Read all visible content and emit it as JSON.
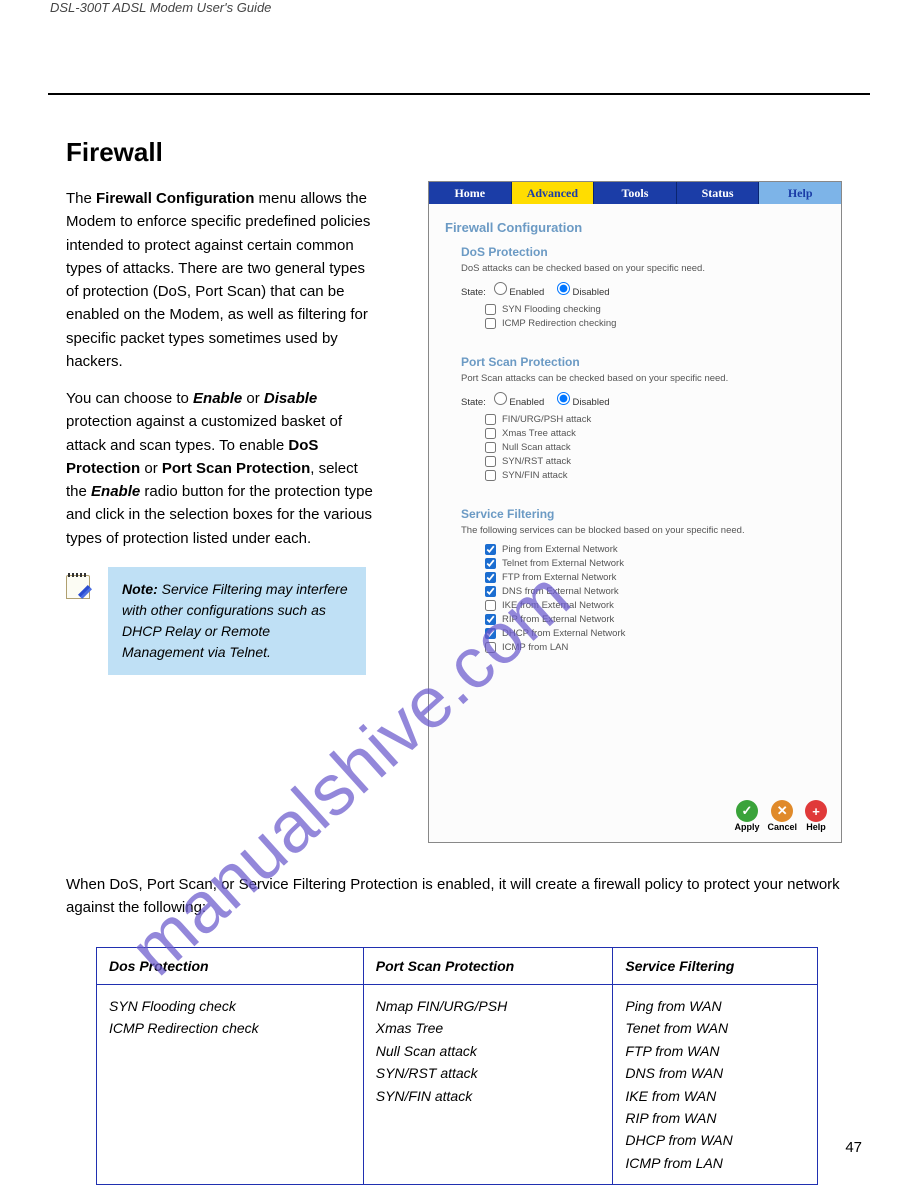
{
  "header": {
    "left": "DSL-300T ADSL Modem User's Guide",
    "right": ""
  },
  "title": "Firewall",
  "body": {
    "p1a": "The ",
    "p1b": "Firewall Configuration",
    "p1c": " menu allows the Modem to enforce specific predefined policies intended to protect against certain common types of attacks. There are two general types of protection (DoS, Port Scan) that can be enabled on the Modem, as well as filtering for specific packet types sometimes used by hackers.",
    "p2a": "You can choose to ",
    "p2b": "Enable",
    "p2c": " or ",
    "p2d": "Disable",
    "p2e": " protection against a customized basket of attack and scan types. To enable ",
    "p2f": "DoS Protection",
    "p2g": " or ",
    "p2h": "Port Scan Protection",
    "p2i": ", select the ",
    "p2j": "Enable",
    "p2k": " radio button for the protection type and click in the selection boxes for the various types of protection listed under each."
  },
  "note": {
    "label": "Note:",
    "text": " Service Filtering may interfere with other configurations such as DHCP Relay or Remote Management via Telnet."
  },
  "screenshot": {
    "nav": {
      "home": "Home",
      "advanced": "Advanced",
      "tools": "Tools",
      "status": "Status",
      "help": "Help"
    },
    "cfg_title": "Firewall Configuration",
    "dos": {
      "title": "DoS Protection",
      "desc": "DoS attacks can be checked based on your specific need.",
      "state_label": "State:",
      "enabled": "Enabled",
      "disabled": "Disabled",
      "items": [
        "SYN Flooding checking",
        "ICMP Redirection checking"
      ]
    },
    "portscan": {
      "title": "Port Scan Protection",
      "desc": "Port Scan attacks can be checked based on your specific need.",
      "state_label": "State:",
      "enabled": "Enabled",
      "disabled": "Disabled",
      "items": [
        "FIN/URG/PSH attack",
        "Xmas Tree attack",
        "Null Scan attack",
        "SYN/RST attack",
        "SYN/FIN attack"
      ]
    },
    "svcfilter": {
      "title": "Service Filtering",
      "desc": "The following services can be blocked based on your specific need.",
      "items": [
        {
          "label": "Ping from External Network",
          "checked": true
        },
        {
          "label": "Telnet from External Network",
          "checked": true
        },
        {
          "label": "FTP from External Network",
          "checked": true
        },
        {
          "label": "DNS from External Network",
          "checked": true
        },
        {
          "label": "IKE from External Network",
          "checked": false
        },
        {
          "label": "RIP from External Network",
          "checked": true
        },
        {
          "label": "DHCP from External Network",
          "checked": true
        },
        {
          "label": "ICMP from LAN",
          "checked": false
        }
      ]
    },
    "buttons": {
      "apply": "Apply",
      "cancel": "Cancel",
      "help": "Help"
    }
  },
  "below": {
    "p1a": "When DoS, Port Scan, or Service Filtering Protection is enabled, it will create a firewall policy to protect your network against the following:"
  },
  "table": {
    "headers": [
      "Dos Protection",
      "Port Scan Protection",
      "Service Filtering"
    ],
    "cols": [
      "SYN Flooding check\nICMP Redirection check",
      "Nmap FIN/URG/PSH\nXmas Tree\nNull Scan attack\nSYN/RST attack\nSYN/FIN attack",
      "Ping from WAN\nTenet from WAN\nFTP from WAN\nDNS from WAN\nIKE from WAN\nRIP from WAN\nDHCP from WAN\nICMP from LAN"
    ]
  },
  "watermark": "manualshive.com",
  "page_number": "47"
}
